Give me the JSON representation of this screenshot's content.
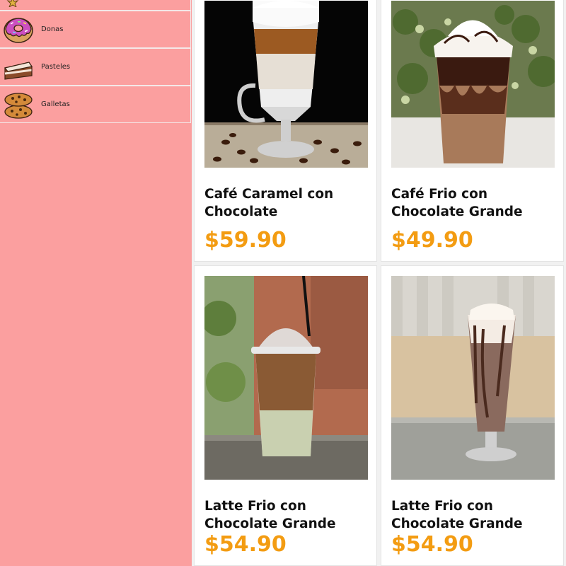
{
  "sidebar": {
    "items": [
      {
        "label": "",
        "icon": "star-icon"
      },
      {
        "label": "Donas",
        "icon": "donut-icon"
      },
      {
        "label": "Pasteles",
        "icon": "cake-slice-icon"
      },
      {
        "label": "Galletas",
        "icon": "cookies-icon"
      }
    ]
  },
  "products": [
    {
      "name": "Café Caramel con Chocolate",
      "price": "$59.90",
      "photo": "layered-caramel-latte-glass-photo"
    },
    {
      "name": "Café Frio con Chocolate Grande",
      "price": "$49.90",
      "photo": "iced-chocolate-frappe-cup-photo"
    },
    {
      "name": "Latte Frio con Chocolate Grande",
      "price": "$54.90",
      "photo": "iced-latte-domed-cup-photo"
    },
    {
      "name": "Latte Frio con Chocolate Grande",
      "price": "$54.90",
      "photo": "chocolate-milkshake-tall-glass-photo"
    }
  ],
  "colors": {
    "sidebar_bg": "#fb9f9f",
    "price": "#f39c12",
    "card_bg": "#ffffff"
  }
}
